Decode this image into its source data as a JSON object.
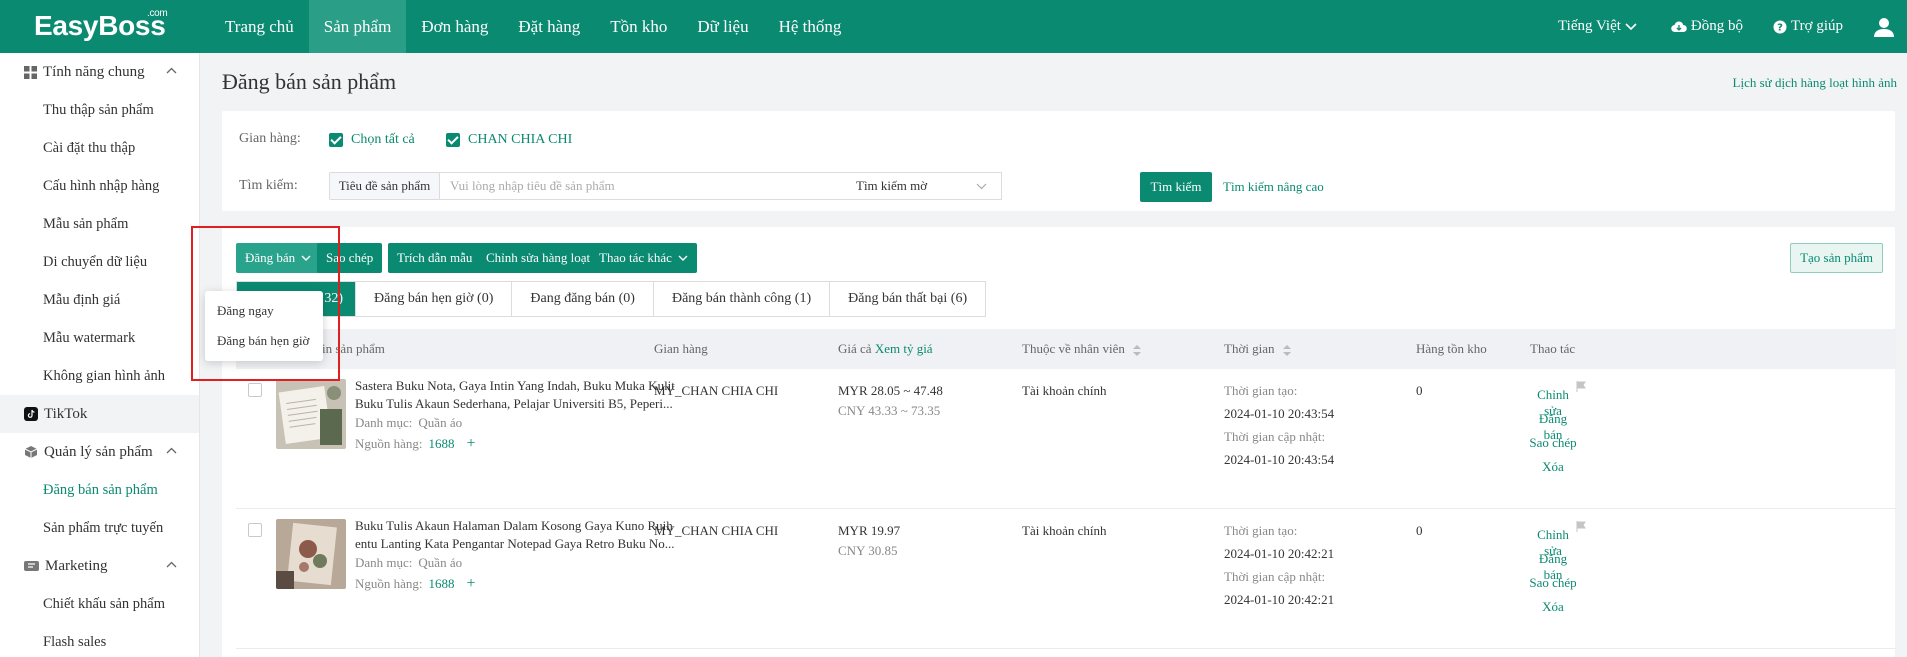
{
  "topbar": {
    "logo": "EasyBoss",
    "logo_sup": ".com",
    "nav": [
      "Trang chủ",
      "Sản phẩm",
      "Đơn hàng",
      "Đặt hàng",
      "Tồn kho",
      "Dữ liệu",
      "Hệ thống"
    ],
    "active_nav": 1,
    "language": "Tiếng Việt",
    "sync": "Đồng bộ",
    "help": "Trợ giúp"
  },
  "sidebar": {
    "group_general": "Tính năng chung",
    "general_items": [
      "Thu thập sản phẩm",
      "Cài đặt thu thập",
      "Cấu hình nhập hàng",
      "Mẫu sản phẩm",
      "Di chuyển dữ liệu",
      "Mẫu định giá",
      "Mẫu watermark",
      "Không gian hình ảnh"
    ],
    "tiktok": "TikTok",
    "group_product": "Quản lý sản phẩm",
    "product_items": [
      "Đăng bán sản phẩm",
      "Sản phẩm trực tuyến"
    ],
    "group_marketing": "Marketing",
    "marketing_items": [
      "Chiết khấu sản phẩm",
      "Flash sales"
    ]
  },
  "page": {
    "title": "Đăng bán sản phẩm",
    "history_link": "Lịch sử dịch hàng loạt hình ảnh"
  },
  "filter": {
    "shop_label": "Gian hàng:",
    "select_all": "Chọn tất cả",
    "shop_name": "CHAN CHIA CHI",
    "search_label": "Tìm kiếm:",
    "search_field": "Tiêu đề sản phẩm",
    "search_placeholder": "Vui lòng nhập tiêu đề sản phẩm",
    "search_mode": "Tìm kiếm mờ",
    "search_button": "Tìm kiếm",
    "advanced_link": "Tìm kiếm nâng cao"
  },
  "toolbar": {
    "publish": "Đăng bán",
    "copy": "Sao chép",
    "extract_template": "Trích dẫn mẫu",
    "bulk_edit": "Chỉnh sửa hàng loạt",
    "other_actions": "Thao tác khác",
    "create_product": "Tạo sản phẩm"
  },
  "dropdown": {
    "items": [
      "Đăng ngay",
      "Đăng bán hẹn giờ"
    ]
  },
  "tabs": [
    {
      "label": "32)"
    },
    {
      "label": "Đăng bán hẹn giờ (0)"
    },
    {
      "label": "Đang đăng bán (0)"
    },
    {
      "label": "Đăng bán thành công (1)"
    },
    {
      "label": "Đăng bán thất bại (6)"
    }
  ],
  "table": {
    "headers": {
      "product": "in sản phẩm",
      "shop": "Gian hàng",
      "price": "Giá cả",
      "price_link": "Xem tỷ giá",
      "employee": "Thuộc về nhân viên",
      "time": "Thời gian",
      "stock": "Hàng tồn kho",
      "actions": "Thao tác"
    },
    "category_label": "Danh mục:",
    "source_label": "Nguồn hàng:",
    "created_label": "Thời gian tạo:",
    "updated_label": "Thời gian cập nhật:",
    "action_labels": [
      "Chỉnh sửa",
      "Đăng bán",
      "Sao chép",
      "Xóa"
    ],
    "rows": [
      {
        "title": "Sastera Buku Nota, Gaya Intin Yang Indah, Buku Muka Kulit Buku Tulis Akaun Sederhana, Pelajar Universiti B5, Peperi...",
        "category": "Quần áo",
        "source": "1688",
        "shop": "MY_CHAN CHIA CHI",
        "price_myr": "MYR 28.05 ~ 47.48",
        "price_cny": "CNY 43.33 ~ 73.35",
        "employee": "Tài khoản chính",
        "created": "2024-01-10 20:43:54",
        "updated": "2024-01-10 20:43:54",
        "stock": "0"
      },
      {
        "title": "Buku Tulis Akaun Halaman Dalam Kosong Gaya Kuno Ruih entu Lanting Kata Pengantar Notepad Gaya Retro Buku No...",
        "category": "Quần áo",
        "source": "1688",
        "shop": "MY_CHAN CHIA CHI",
        "price_myr": "MYR 19.97",
        "price_cny": "CNY 30.85",
        "employee": "Tài khoản chính",
        "created": "2024-01-10 20:42:21",
        "updated": "2024-01-10 20:42:21",
        "stock": "0"
      }
    ]
  },
  "colors": {
    "primary": "#0b8a72",
    "highlight": "#e02020"
  }
}
